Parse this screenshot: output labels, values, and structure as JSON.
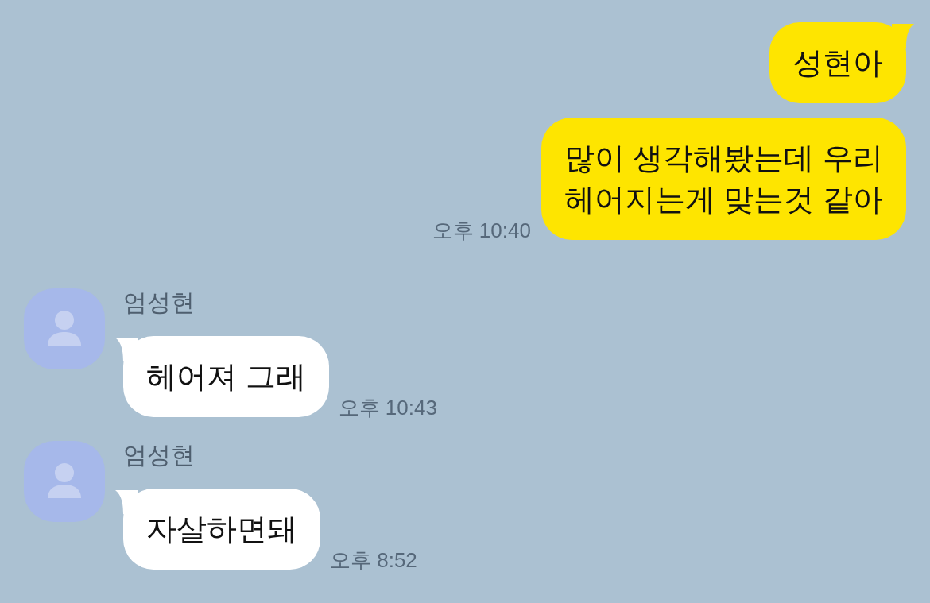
{
  "messages": [
    {
      "kind": "sent",
      "text": "성현아",
      "tail": true
    },
    {
      "kind": "sent",
      "text": "많이 생각해봤는데 우리\n헤어지는게 맞는것 같아",
      "tail": false,
      "time": "오후 10:40"
    },
    {
      "kind": "received",
      "sender": "엄성현",
      "text": "헤어져 그래",
      "time": "오후 10:43"
    },
    {
      "kind": "received",
      "sender": "엄성현",
      "text": "자살하면돼",
      "time": "오후 8:52"
    }
  ]
}
